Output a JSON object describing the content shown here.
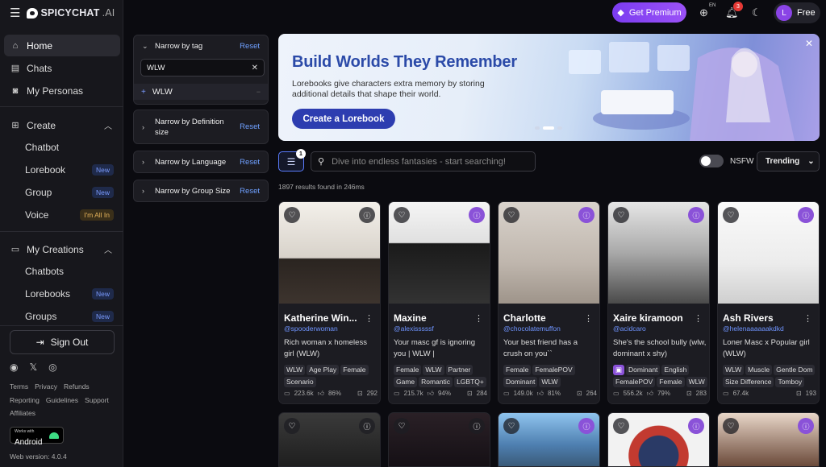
{
  "app": {
    "logo_main": "SPICYCHAT",
    "logo_suffix": ".AI"
  },
  "sidebar": {
    "home": "Home",
    "chats": "Chats",
    "personas": "My Personas",
    "create": "Create",
    "create_items": [
      {
        "label": "Chatbot",
        "badge": ""
      },
      {
        "label": "Lorebook",
        "badge": "New"
      },
      {
        "label": "Group",
        "badge": "New"
      },
      {
        "label": "Voice",
        "badge": "I'm All In"
      }
    ],
    "my_creations": "My Creations",
    "creation_items": [
      {
        "label": "Chatbots",
        "badge": ""
      },
      {
        "label": "Lorebooks",
        "badge": "New"
      },
      {
        "label": "Groups",
        "badge": "New"
      }
    ],
    "sign_out": "Sign Out",
    "links_row1": [
      "Terms",
      "Privacy",
      "Refunds"
    ],
    "links_row2": [
      "Reporting",
      "Guidelines",
      "Support"
    ],
    "links_row3": [
      "Affiliates"
    ],
    "android_small": "Works with",
    "android_big": "Android",
    "version": "Web version: 4.0.4"
  },
  "topbar": {
    "premium": "Get Premium",
    "lang": "EN",
    "notifications": "3",
    "avatar_letter": "L",
    "plan": "Free"
  },
  "filters": {
    "tag": {
      "title": "Narrow by tag",
      "reset": "Reset",
      "input_value": "WLW",
      "selected": "WLW"
    },
    "definition": {
      "title": "Narrow by Definition size",
      "reset": "Reset"
    },
    "language": {
      "title": "Narrow by Language",
      "reset": "Reset"
    },
    "group_size": {
      "title": "Narrow by Group Size",
      "reset": "Reset"
    }
  },
  "banner": {
    "title": "Build Worlds They Remember",
    "text": "Lorebooks give characters extra memory by storing additional details that shape their world.",
    "cta": "Create a Lorebook"
  },
  "search": {
    "filter_count": "1",
    "placeholder": "Dive into endless fantasies - start searching!",
    "nsfw_label": "NSFW",
    "sort": "Trending",
    "results": "1897 results found in 246ms"
  },
  "cards": [
    {
      "name": "Katherine Win...",
      "handle": "@spooderwoman",
      "desc": "Rich woman x homeless girl (WLW)",
      "tags": [
        "WLW",
        "Age Play",
        "Female",
        "Scenario"
      ],
      "chats": "223.6k",
      "likes": "86%",
      "tokens": "292"
    },
    {
      "name": "Maxine",
      "handle": "@alexisssssf",
      "desc": "Your masc gf is ignoring you | WLW |",
      "tags": [
        "Female",
        "WLW",
        "Partner",
        "Game",
        "Romantic",
        "LGBTQ+"
      ],
      "chats": "215.7k",
      "likes": "94%",
      "tokens": "284"
    },
    {
      "name": "Charlotte",
      "handle": "@chocolatemuffon",
      "desc": "Your best friend has a crush on you``",
      "tags": [
        "Female",
        "FemalePOV",
        "Dominant",
        "WLW"
      ],
      "chats": "149.0k",
      "likes": "81%",
      "tokens": "264"
    },
    {
      "name": "Xaire kiramoon",
      "handle": "@acidcaro",
      "desc": "She's the school bully (wlw, dominant x shy)",
      "tags": [
        "▣",
        "Dominant",
        "English",
        "FemalePOV",
        "Female",
        "WLW"
      ],
      "chats": "556.2k",
      "likes": "79%",
      "tokens": "283"
    },
    {
      "name": "Ash Rivers",
      "handle": "@helenaaaaaakdkd",
      "desc": "Loner Masc x Popular girl (WLW)",
      "tags": [
        "WLW",
        "Muscle",
        "Gentle Dom",
        "Size Difference",
        "Tomboy"
      ],
      "chats": "67.4k",
      "likes": "",
      "tokens": "193"
    }
  ]
}
